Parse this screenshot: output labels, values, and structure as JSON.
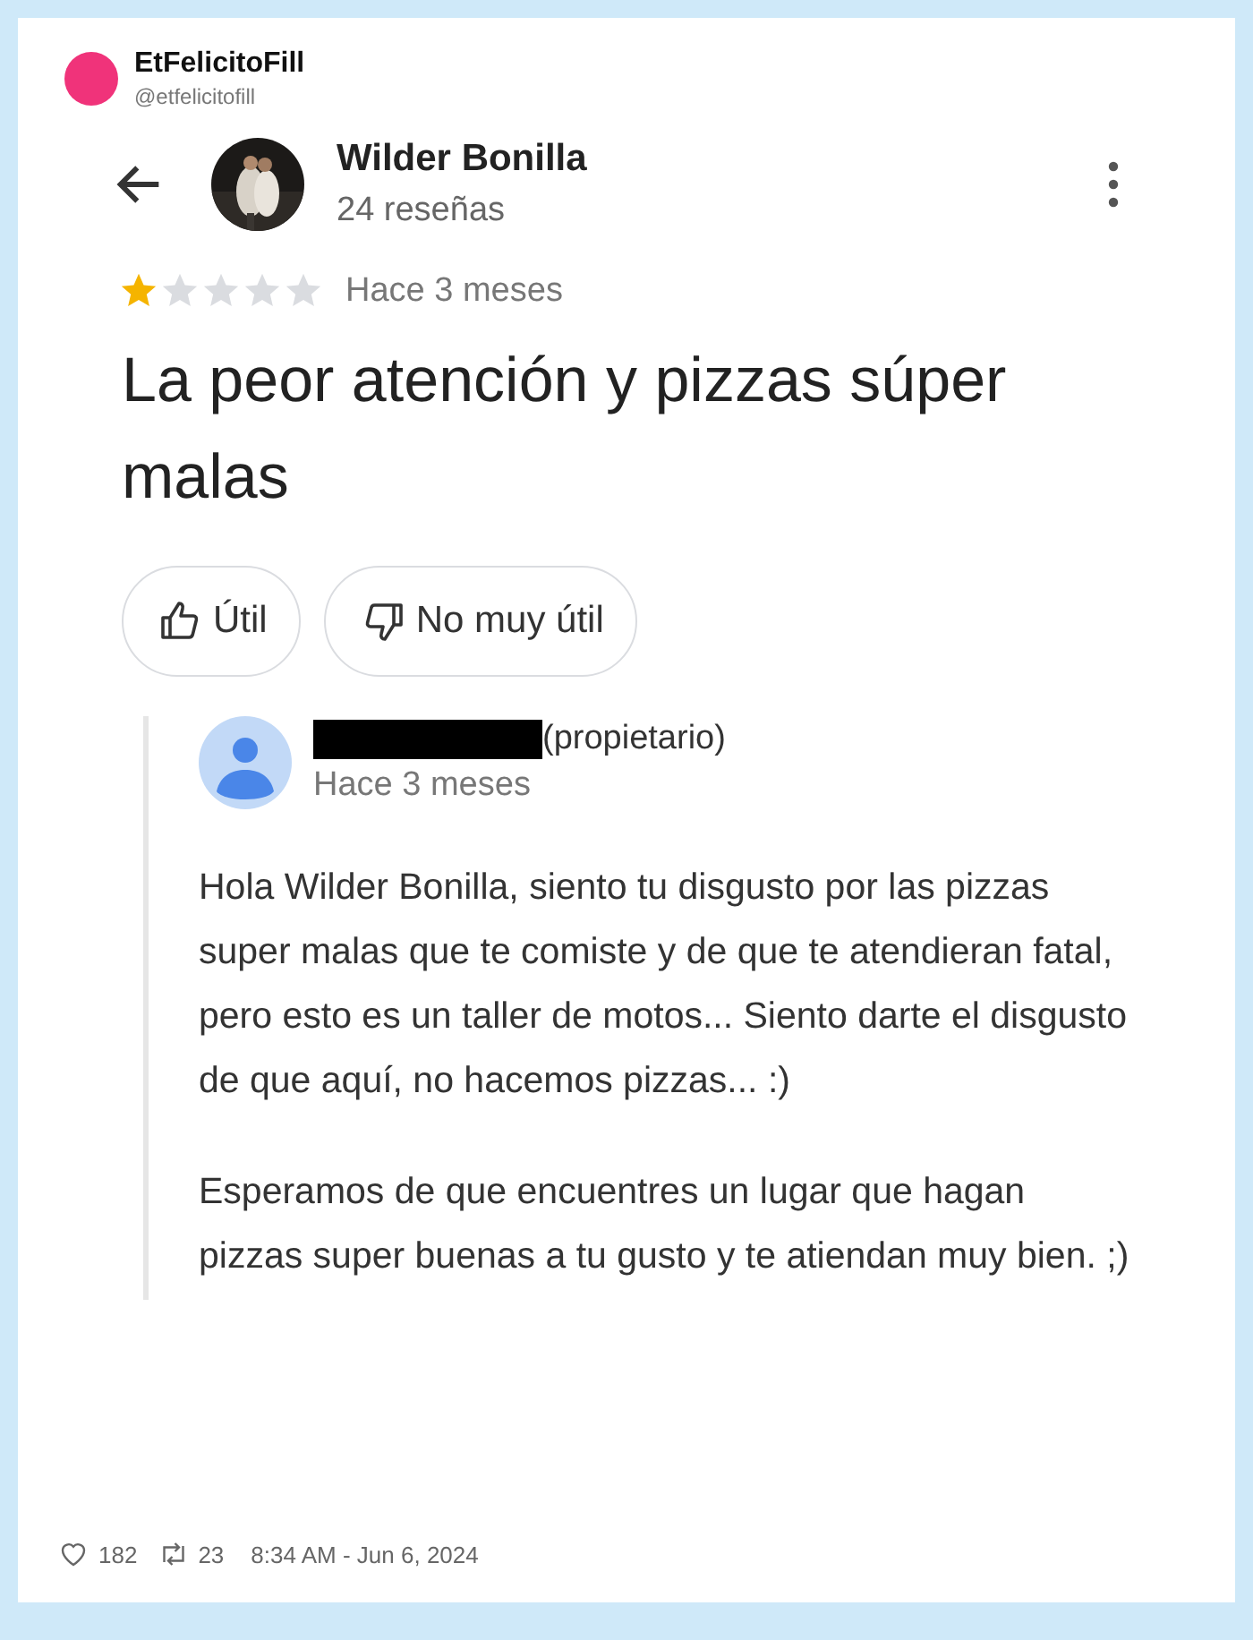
{
  "tweet": {
    "author": "EtFelicitoFill",
    "handle": "@etfelicitofill",
    "likes": "182",
    "retweets": "23",
    "timestamp": "8:34 AM - Jun 6, 2024"
  },
  "review": {
    "reviewer": "Wilder Bonilla",
    "review_count": "24 reseñas",
    "stars": 1,
    "time": "Hace 3 meses",
    "title": "La peor atención y pizzas súper malas",
    "buttons": [
      {
        "kind": "like",
        "label": "Útil"
      },
      {
        "kind": "dislike",
        "label": "No muy útil"
      }
    ]
  },
  "reply": {
    "role": "(propietario)",
    "time": "Hace 3 meses",
    "paragraphs": [
      "Hola Wilder Bonilla, siento tu disgusto por las pizzas super malas que te comiste y de que te atendieran fatal, pero esto es un taller de motos... Siento darte el disgusto de que aquí, no hacemos pizzas... :)",
      "Esperamos de que encuentres un lugar que hagan pizzas super buenas a tu gusto y te atiendan muy bien. ;)"
    ]
  }
}
